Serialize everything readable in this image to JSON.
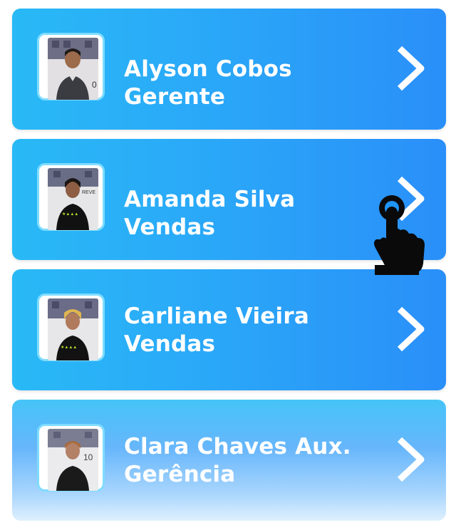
{
  "contacts": [
    {
      "name": "Alyson Cobos Gerente",
      "photo_icon": "person-photo-icon",
      "chevron_icon": "chevron-right-icon"
    },
    {
      "name": "Amanda Silva Vendas",
      "photo_icon": "person-photo-icon",
      "chevron_icon": "chevron-right-icon"
    },
    {
      "name": "Carliane Vieira Vendas",
      "photo_icon": "person-photo-icon",
      "chevron_icon": "chevron-right-icon"
    },
    {
      "name": "Clara Chaves Aux. Gerência",
      "photo_icon": "person-photo-icon",
      "chevron_icon": "chevron-right-icon"
    }
  ],
  "pointer_icon": "hand-pointer-icon",
  "colors": {
    "card_gradient_start": "#29b9f6",
    "card_gradient_end": "#2a8ff9",
    "photo_border": "#7fdcff",
    "text": "#ffffff"
  }
}
